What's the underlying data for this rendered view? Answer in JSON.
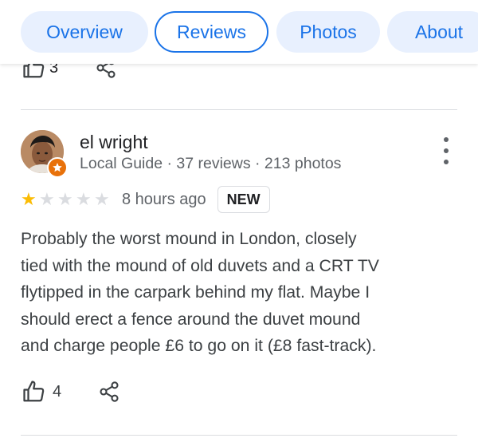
{
  "tabs": [
    {
      "label": "Overview",
      "active": false
    },
    {
      "label": "Reviews",
      "active": true
    },
    {
      "label": "Photos",
      "active": false
    },
    {
      "label": "About",
      "active": false
    }
  ],
  "previous_review": {
    "like_count": "3"
  },
  "review": {
    "reviewer_name": "el wright",
    "reviewer_meta": "Local Guide · 37 reviews · 213 photos",
    "rating": 1,
    "max_rating": 5,
    "time": "8 hours ago",
    "badge": "NEW",
    "text": "Probably the worst mound in London, closely\ntied with the mound of old duvets and a CRT TV\nflytipped in the carpark behind my flat. Maybe I\nshould erect a fence around the duvet mound\nand charge people £6 to go on it (£8 fast-track).",
    "like_count": "4"
  },
  "icons": {
    "like": "thumbs-up-icon",
    "share": "share-icon",
    "more": "more-vert-icon",
    "badge": "local-guide-badge-icon",
    "star": "star-icon"
  },
  "colors": {
    "accent": "#1a73e8",
    "tab_bg": "#e8f0fe",
    "star_on": "#fbbc04",
    "star_off": "#dadce0",
    "guide_badge": "#e8710a"
  }
}
